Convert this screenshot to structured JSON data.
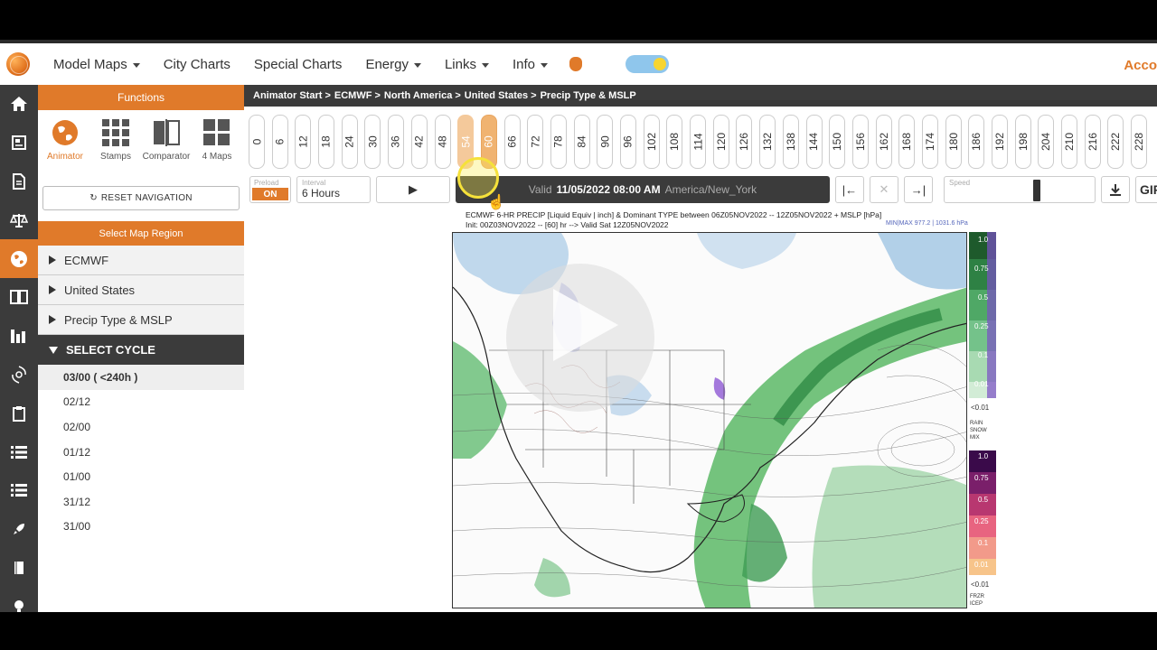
{
  "nav": {
    "items": [
      {
        "label": "Model Maps",
        "caret": true
      },
      {
        "label": "City Charts",
        "caret": false
      },
      {
        "label": "Special Charts",
        "caret": false
      },
      {
        "label": "Energy",
        "caret": true
      },
      {
        "label": "Links",
        "caret": true
      },
      {
        "label": "Info",
        "caret": true
      }
    ],
    "account": "Acco"
  },
  "functions": {
    "header": "Functions",
    "items": [
      {
        "label": "Animator",
        "icon": "globe-icon",
        "active": true
      },
      {
        "label": "Stamps",
        "icon": "grid-icon",
        "active": false
      },
      {
        "label": "Comparator",
        "icon": "compare-icon",
        "active": false
      },
      {
        "label": "4 Maps",
        "icon": "four-maps-icon",
        "active": false
      }
    ],
    "reset_label": "RESET NAVIGATION",
    "region_header": "Select Map Region"
  },
  "accordion": {
    "model": "ECMWF",
    "region": "United States",
    "product": "Precip Type & MSLP",
    "cycle_header": "SELECT CYCLE",
    "cycles": [
      "03/00 ( <240h )",
      "02/12",
      "02/00",
      "01/12",
      "01/00",
      "31/12",
      "31/00"
    ]
  },
  "breadcrumb": [
    "Animator Start >",
    "ECMWF >",
    "North America >",
    "United States >",
    "Precip Type & MSLP"
  ],
  "hours": [
    "0",
    "6",
    "12",
    "18",
    "24",
    "30",
    "36",
    "42",
    "48",
    "54",
    "60",
    "66",
    "72",
    "78",
    "84",
    "90",
    "96",
    "102",
    "108",
    "114",
    "120",
    "126",
    "132",
    "138",
    "144",
    "150",
    "156",
    "162",
    "168",
    "174",
    "180",
    "186",
    "192",
    "198",
    "204",
    "210",
    "216",
    "222",
    "228"
  ],
  "current_hour": "60",
  "controls": {
    "preload_label": "Preload",
    "preload_value": "ON",
    "interval_label": "Interval",
    "interval_value": "6 Hours",
    "valid_prefix": "Valid",
    "valid_datetime": "11/05/2022 08:00 AM",
    "valid_tz": "America/New_York",
    "speed_label": "Speed",
    "gif_label": "GIF"
  },
  "map": {
    "title_line1": "ECMWF 6-HR PRECIP [Liquid Equiv | inch] & Dominant TYPE between 06Z05NOV2022 -- 12Z05NOV2022 + MSLP [hPa]",
    "title_line2": "Init: 00Z03NOV2022 -- [60] hr --> Valid Sat 12Z05NOV2022",
    "minmax": "MIN|MAX 977.2 | 1031.6 hPa",
    "legend_top": [
      "1.0",
      "0.75",
      "0.5",
      "0.25",
      "0.1",
      "0.01"
    ],
    "legend_lt": "<0.01",
    "legend_mid": "RAIN SNOW MIX",
    "legend_bottom": [
      "1.0",
      "0.75",
      "0.5",
      "0.25",
      "0.1",
      "0.01"
    ],
    "legend_lt2": "<0.01",
    "legend_foot": "FRZR ICEP"
  }
}
